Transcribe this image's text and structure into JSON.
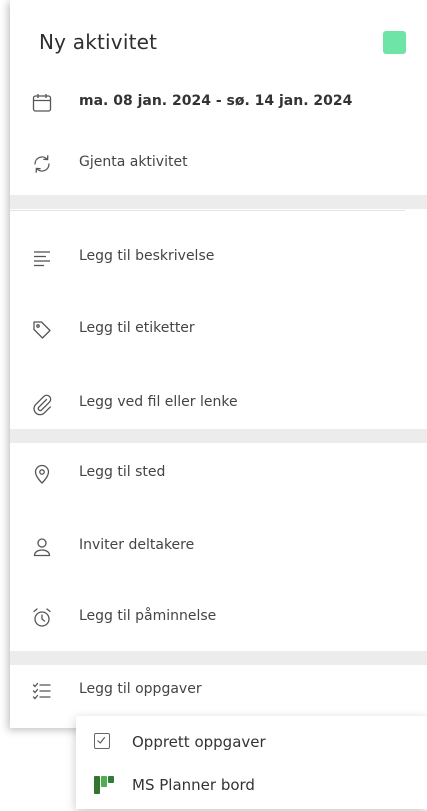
{
  "header": {
    "title": "Ny aktivitet",
    "color_swatch": "#6fe4a7"
  },
  "rows": {
    "date": {
      "label": "ma. 08 jan. 2024 - sø. 14 jan. 2024",
      "icon": "calendar-icon"
    },
    "repeat": {
      "label": "Gjenta aktivitet",
      "icon": "repeat-icon"
    },
    "description": {
      "label": "Legg til beskrivelse",
      "icon": "text-lines-icon"
    },
    "tags": {
      "label": "Legg til etiketter",
      "icon": "tag-icon"
    },
    "attachment": {
      "label": "Legg ved fil eller lenke",
      "icon": "paperclip-icon"
    },
    "location": {
      "label": "Legg til sted",
      "icon": "location-pin-icon"
    },
    "invite": {
      "label": "Inviter deltakere",
      "icon": "person-icon"
    },
    "reminder": {
      "label": "Legg til påminnelse",
      "icon": "alarm-clock-icon"
    },
    "tasks": {
      "label": "Legg til oppgaver",
      "icon": "checklist-icon"
    }
  },
  "dropdown": {
    "items": [
      {
        "label": "Opprett oppgaver",
        "icon": "checkbox-icon"
      },
      {
        "label": "MS Planner bord",
        "icon": "ms-planner-icon"
      }
    ]
  },
  "colors": {
    "accent": "#6fe4a7",
    "divider": "#ececec",
    "icon": "#555555",
    "planner_green": "#31752f"
  }
}
